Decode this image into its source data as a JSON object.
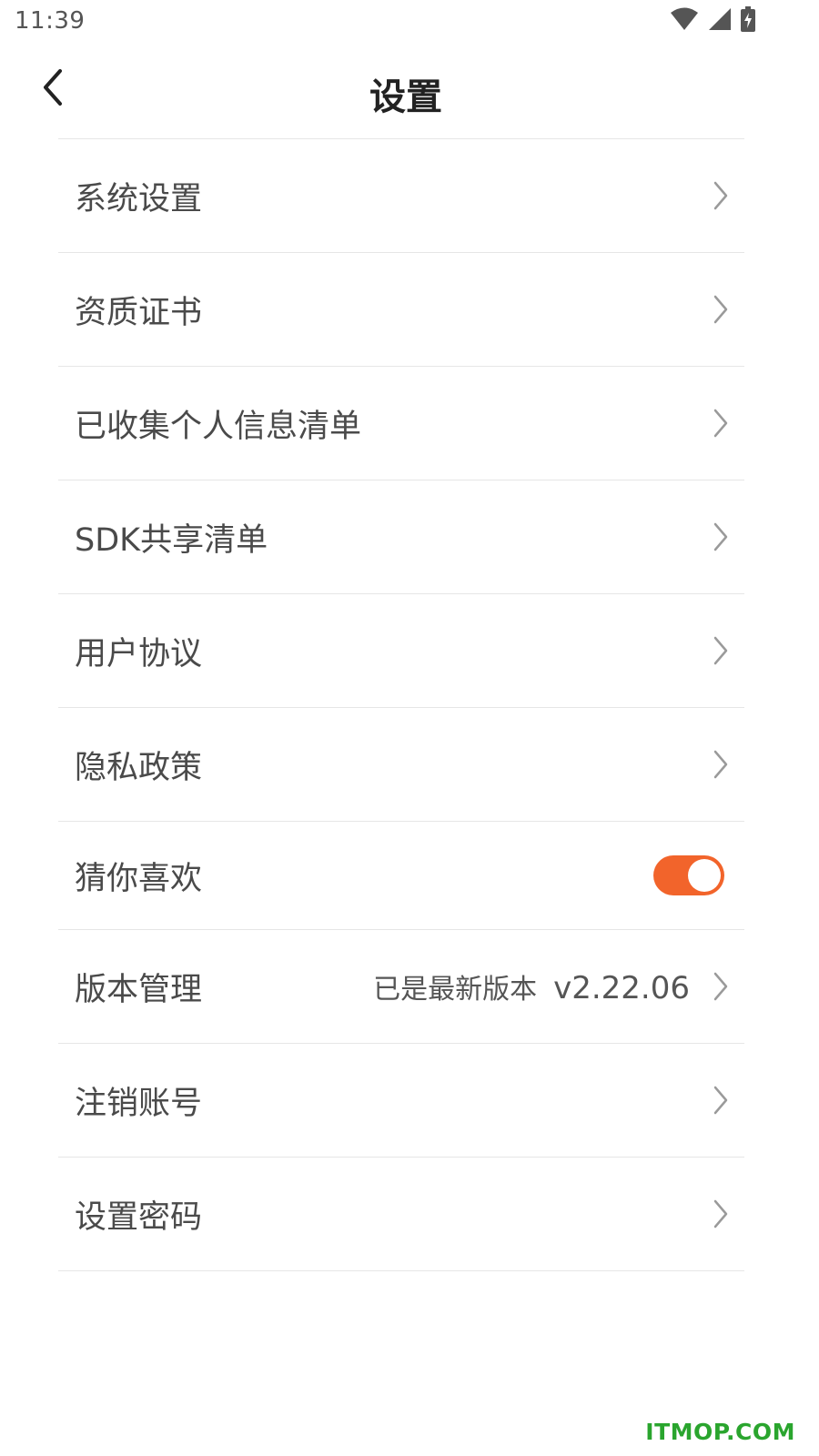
{
  "status_bar": {
    "time": "11:39",
    "icons": [
      "wifi-icon",
      "cellular-signal-icon",
      "battery-charging-icon"
    ]
  },
  "header": {
    "title": "设置",
    "back_icon": "chevron-left-icon"
  },
  "menu": {
    "items": [
      {
        "label": "系统设置"
      },
      {
        "label": "资质证书"
      },
      {
        "label": "已收集个人信息清单"
      },
      {
        "label": "SDK共享清单"
      },
      {
        "label": "用户协议"
      },
      {
        "label": "隐私政策"
      },
      {
        "label": "猜你喜欢",
        "toggle_on": true
      },
      {
        "label": "版本管理",
        "status": "已是最新版本",
        "version": "v2.22.06"
      },
      {
        "label": "注销账号"
      },
      {
        "label": "设置密码"
      }
    ]
  },
  "watermark": "ITMOP.COM",
  "colors": {
    "accent": "#f2642b",
    "text": "#4a4a4a",
    "divider": "#e6e6e6",
    "watermark": "#2aa52e"
  }
}
